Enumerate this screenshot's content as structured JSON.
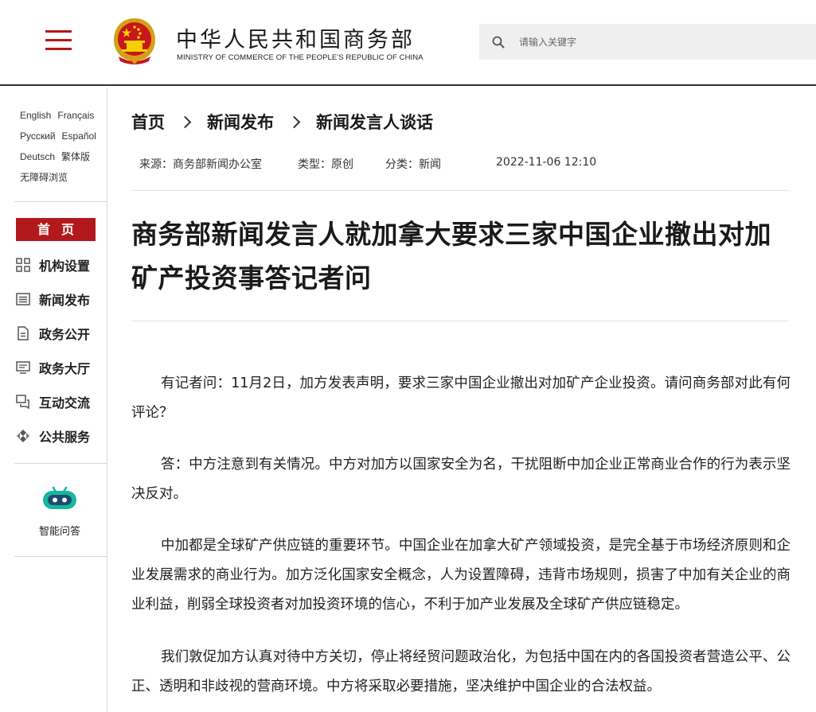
{
  "header": {
    "title": "中华人民共和国商务部",
    "subtitle": "MINISTRY OF COMMERCE OF THE PEOPLE'S REPUBLIC OF CHINA",
    "search_placeholder": "请输入关键字",
    "accent_color": "#b3191c"
  },
  "sidebar": {
    "languages": [
      "English",
      "Français",
      "Русский",
      "Español",
      "Deutsch",
      "繁体版",
      "无障碍浏览"
    ],
    "home_label": "首页",
    "nav_items": [
      {
        "label": "机构设置",
        "icon": "org-grid-icon"
      },
      {
        "label": "新闻发布",
        "icon": "news-list-icon"
      },
      {
        "label": "政务公开",
        "icon": "document-icon"
      },
      {
        "label": "政务大厅",
        "icon": "monitor-icon"
      },
      {
        "label": "互动交流",
        "icon": "chat-icon"
      },
      {
        "label": "公共服务",
        "icon": "service-diamond-icon"
      }
    ],
    "assistant_label": "智能问答"
  },
  "breadcrumb": [
    "首页",
    "新闻发布",
    "新闻发言人谈话"
  ],
  "meta": {
    "source": "来源：商务部新闻办公室",
    "type": "类型：原创",
    "category": "分类：新闻",
    "datetime": "2022-11-06 12:10"
  },
  "article": {
    "title": "商务部新闻发言人就加拿大要求三家中国企业撤出对加矿产投资事答记者问",
    "paragraphs": [
      "有记者问：11月2日，加方发表声明，要求三家中国企业撤出对加矿产企业投资。请问商务部对此有何评论？",
      "答：中方注意到有关情况。中方对加方以国家安全为名，干扰阻断中加企业正常商业合作的行为表示坚决反对。",
      "中加都是全球矿产供应链的重要环节。中国企业在加拿大矿产领域投资，是完全基于市场经济原则和企业发展需求的商业行为。加方泛化国家安全概念，人为设置障碍，违背市场规则，损害了中加有关企业的商业利益，削弱全球投资者对加投资环境的信心，不利于加产业发展及全球矿产供应链稳定。",
      "我们敦促加方认真对待中方关切，停止将经贸问题政治化，为包括中国在内的各国投资者营造公平、公正、透明和非歧视的营商环境。中方将采取必要措施，坚决维护中国企业的合法权益。"
    ]
  }
}
